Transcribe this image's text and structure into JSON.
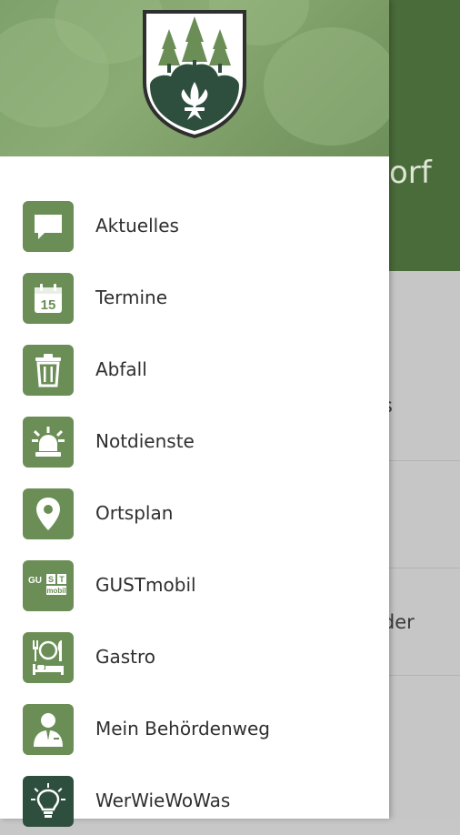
{
  "background": {
    "title_fragment": "orf",
    "items": [
      {
        "text": "as"
      },
      {
        "text": "eder"
      }
    ]
  },
  "menu": {
    "items": [
      {
        "label": "Aktuelles",
        "icon": "chat-bubble-icon"
      },
      {
        "label": "Termine",
        "icon": "calendar-icon",
        "icon_text": "15"
      },
      {
        "label": "Abfall",
        "icon": "trash-icon"
      },
      {
        "label": "Notdienste",
        "icon": "siren-icon"
      },
      {
        "label": "Ortsplan",
        "icon": "map-pin-icon"
      },
      {
        "label": "GUSTmobil",
        "icon": "gustmobil-logo-icon",
        "icon_text": [
          "GU",
          "S",
          "T",
          "mobil"
        ]
      },
      {
        "label": "Gastro",
        "icon": "plate-bed-icon"
      },
      {
        "label": "Mein Behördenweg",
        "icon": "person-icon"
      },
      {
        "label": "WerWieWoWas",
        "icon": "lightbulb-icon"
      }
    ]
  },
  "colors": {
    "accent": "#6a8e55",
    "header_dark": "#4a6b3a",
    "crest_dark": "#2f4f3e"
  }
}
